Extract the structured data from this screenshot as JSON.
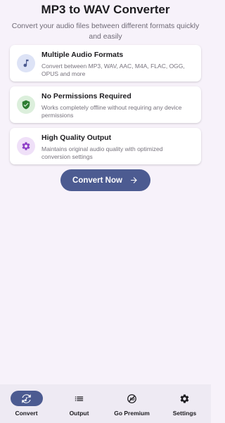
{
  "header": {
    "title": "MP3 to WAV Converter",
    "subtitle": "Convert your audio files between different formats quickly and easily"
  },
  "features": [
    {
      "title": "Multiple Audio Formats",
      "description": "Convert between MP3, WAV, AAC, M4A, FLAC, OGG, OPUS and more",
      "icon": "music-note-icon",
      "icon_color": "#4c5b91",
      "icon_bg": "#dde3f6"
    },
    {
      "title": "No Permissions Required",
      "description": "Works completely offline without requiring any device permissions",
      "icon": "shield-check-icon",
      "icon_color": "#2e7d32",
      "icon_bg": "#dcefdc"
    },
    {
      "title": "High Quality Output",
      "description": "Maintains original audio quality with optimized conversion settings",
      "icon": "gear-icon",
      "icon_color": "#8e3fc7",
      "icon_bg": "#efe0f8"
    }
  ],
  "actions": {
    "convert_label": "Convert Now"
  },
  "bottom_nav": {
    "items": [
      {
        "label": "Convert",
        "icon": "convert-icon",
        "active": true
      },
      {
        "label": "Output",
        "icon": "list-icon",
        "active": false
      },
      {
        "label": "Go Premium",
        "icon": "no-ads-icon",
        "active": false
      },
      {
        "label": "Settings",
        "icon": "gear-icon",
        "active": false
      }
    ]
  },
  "colors": {
    "background": "#f7f2fa",
    "accent": "#4c5b91",
    "nav_background": "#eeeaf3"
  }
}
